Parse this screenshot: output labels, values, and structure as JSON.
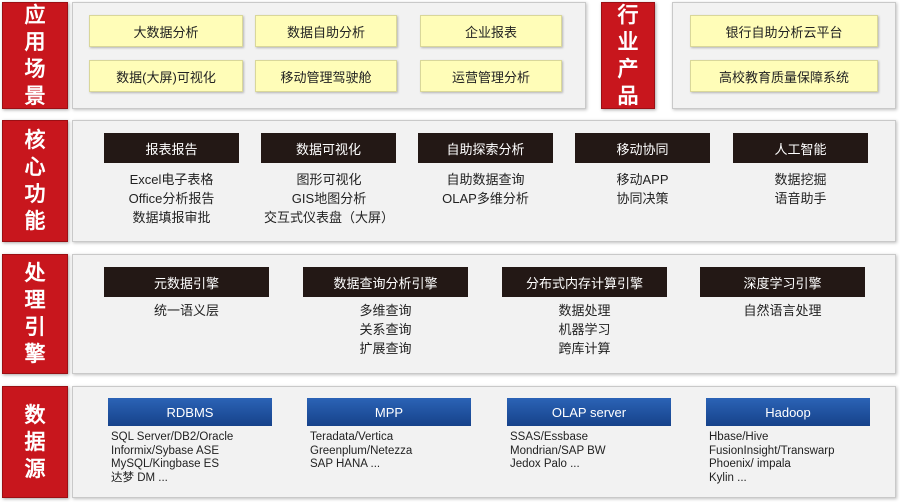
{
  "rows": {
    "scenarios": {
      "label": "应用场景",
      "items": [
        "大数据分析",
        "数据自助分析",
        "企业报表",
        "数据(大屏)可视化",
        "移动管理驾驶舱",
        "运营管理分析"
      ]
    },
    "products": {
      "label": "行业产品",
      "items": [
        "银行自助分析云平台",
        "高校教育质量保障系统"
      ]
    },
    "functions": {
      "label": "核心功能",
      "groups": [
        {
          "title": "报表报告",
          "items": [
            "Excel电子表格",
            "Office分析报告",
            "数据填报审批"
          ]
        },
        {
          "title": "数据可视化",
          "items": [
            "图形可视化",
            "GIS地图分析",
            "交互式仪表盘（大屏）"
          ]
        },
        {
          "title": "自助探索分析",
          "items": [
            "自助数据查询",
            "OLAP多维分析"
          ]
        },
        {
          "title": "移动协同",
          "items": [
            "移动APP",
            "协同决策"
          ]
        },
        {
          "title": "人工智能",
          "items": [
            "数据挖掘",
            "语音助手"
          ]
        }
      ]
    },
    "engines": {
      "label": "处理引擎",
      "groups": [
        {
          "title": "元数据引擎",
          "items": [
            "统一语义层"
          ]
        },
        {
          "title": "数据查询分析引擎",
          "items": [
            "多维查询",
            "关系查询",
            "扩展查询"
          ]
        },
        {
          "title": "分布式内存计算引擎",
          "items": [
            "数据处理",
            "机器学习",
            "跨库计算"
          ]
        },
        {
          "title": "深度学习引擎",
          "items": [
            "自然语言处理"
          ]
        }
      ]
    },
    "sources": {
      "label": "数据源",
      "groups": [
        {
          "title": "RDBMS",
          "items": [
            "SQL Server/DB2/Oracle",
            "Informix/Sybase ASE",
            "MySQL/Kingbase ES",
            "达梦 DM ..."
          ]
        },
        {
          "title": "MPP",
          "items": [
            "Teradata/Vertica",
            "Greenplum/Netezza",
            "SAP HANA ..."
          ]
        },
        {
          "title": "OLAP server",
          "items": [
            "SSAS/Essbase",
            "Mondrian/SAP BW",
            "Jedox Palo ..."
          ]
        },
        {
          "title": "Hadoop",
          "items": [
            "Hbase/Hive",
            "FusionInsight/Transwarp",
            "Phoenix/ impala",
            "Kylin ..."
          ]
        }
      ]
    }
  },
  "colors": {
    "label_red": "#c8161d",
    "panel_gray": "#f2f2f2",
    "note_yellow": "#fffdb8",
    "dark_box": "#231815",
    "blue_box": "#1b4f9c"
  }
}
